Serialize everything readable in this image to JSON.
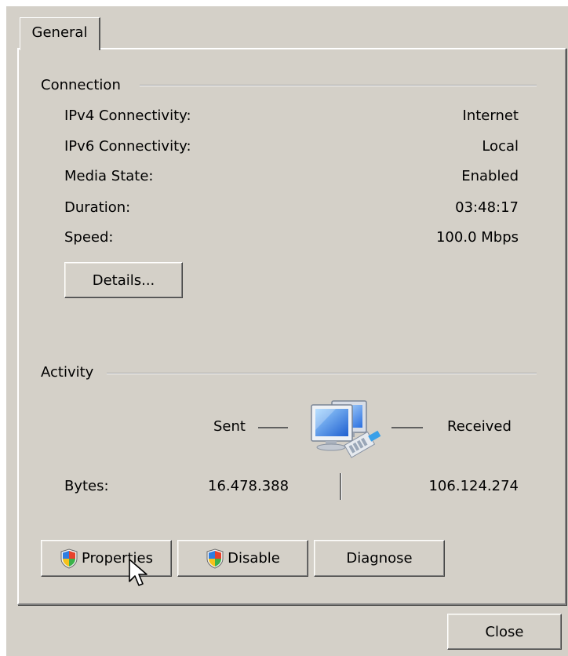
{
  "tabs": [
    {
      "label": "General"
    }
  ],
  "connection": {
    "title": "Connection",
    "rows": [
      {
        "label": "IPv4 Connectivity:",
        "value": "Internet"
      },
      {
        "label": "IPv6 Connectivity:",
        "value": "Local"
      },
      {
        "label": "Media State:",
        "value": "Enabled"
      },
      {
        "label": "Duration:",
        "value": "03:48:17"
      },
      {
        "label": "Speed:",
        "value": "100.0 Mbps"
      }
    ],
    "details_button": "Details..."
  },
  "activity": {
    "title": "Activity",
    "sent_label": "Sent",
    "received_label": "Received",
    "bytes_label": "Bytes:",
    "bytes_sent": "16.478.388",
    "bytes_received": "106.124.274",
    "icon": "network-computers-icon"
  },
  "actions": {
    "properties": "Properties",
    "disable": "Disable",
    "diagnose": "Diagnose"
  },
  "footer": {
    "close": "Close"
  },
  "colors": {
    "dialog_bg": "#d4d0c8",
    "groove": "#a0a0a0"
  }
}
